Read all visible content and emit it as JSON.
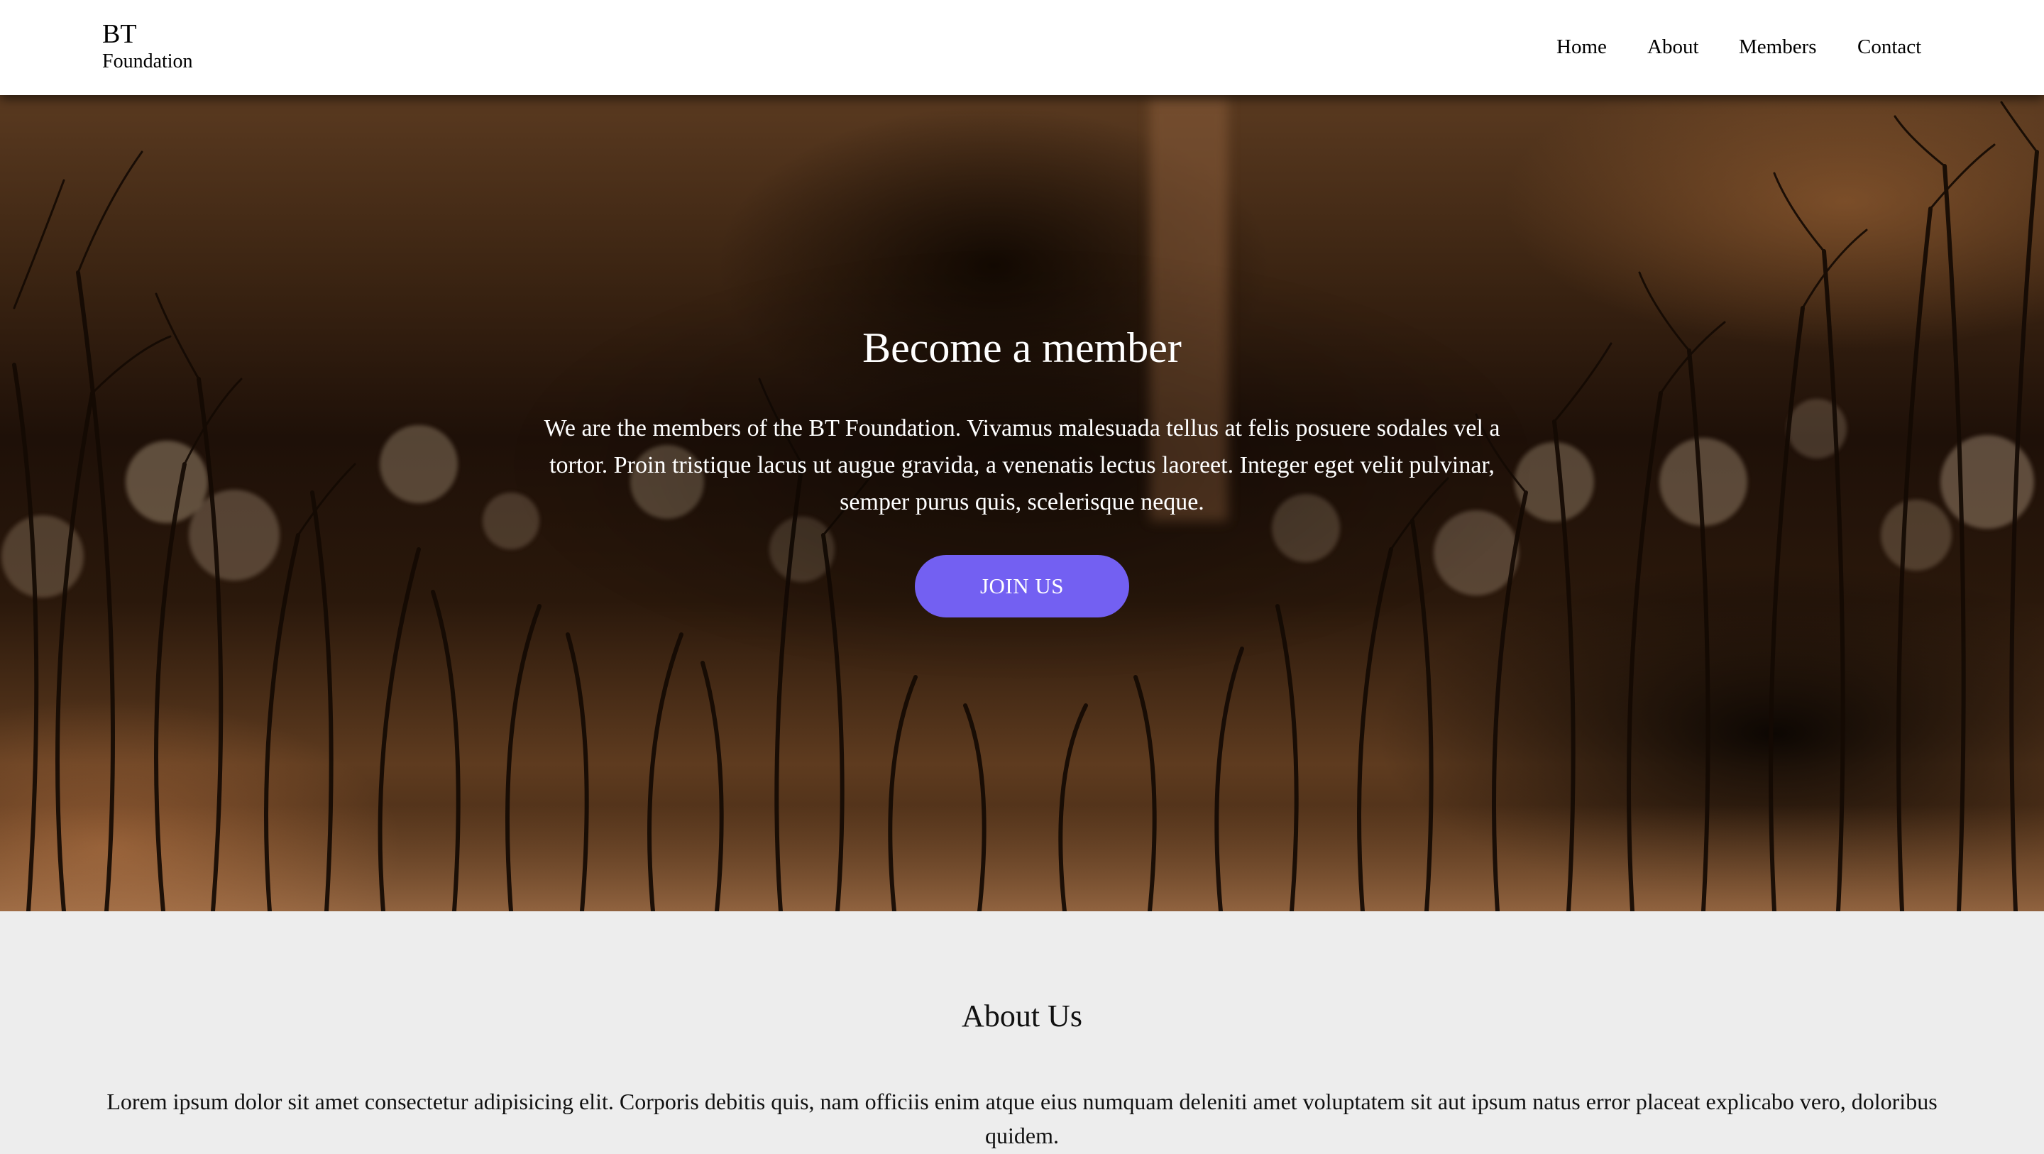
{
  "header": {
    "brand_title": "BT",
    "brand_subtitle": "Foundation",
    "nav": [
      {
        "label": "Home"
      },
      {
        "label": "About"
      },
      {
        "label": "Members"
      },
      {
        "label": "Contact"
      }
    ]
  },
  "hero": {
    "title": "Become a member",
    "text": "We are the members of the BT Foundation. Vivamus malesuada tellus at felis posuere sodales vel a tortor. Proin tristique lacus ut augue gravida, a venenatis lectus laoreet. Integer eget velit pulvinar, semper purus quis, scelerisque neque.",
    "button_label": "JOIN US"
  },
  "about": {
    "title": "About Us",
    "text": "Lorem ipsum dolor sit amet consectetur adipisicing elit. Corporis debitis quis, nam officiis enim atque eius numquam deleniti amet voluptatem sit aut ipsum natus error placeat explicabo vero, doloribus quidem."
  },
  "colors": {
    "accent": "#7360f2",
    "header_bg": "#ffffff",
    "page_bg": "#ededed"
  }
}
